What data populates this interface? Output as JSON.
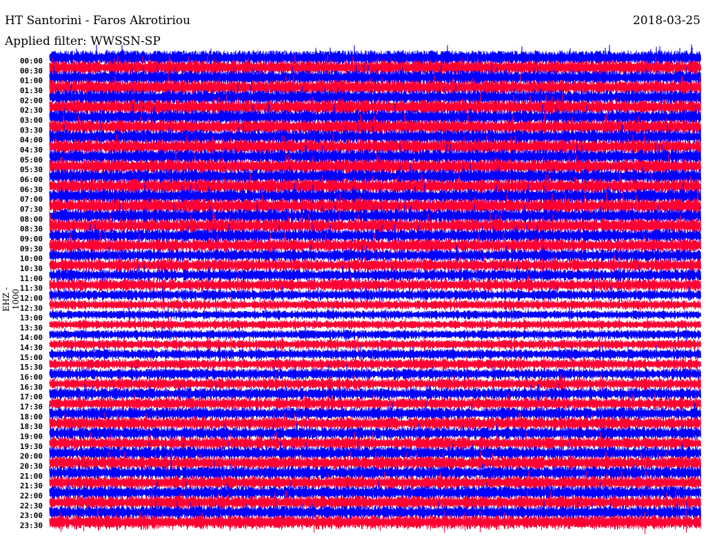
{
  "header": {
    "station": "HT Santorini - Faros Akrotiriou",
    "date": "2018-03-25",
    "filter": "Applied filter: WWSSN-SP",
    "channel": "EHZ - 1000"
  },
  "colors": {
    "trace_a": "#0000ff",
    "trace_b": "#ff0033"
  },
  "chart_data": {
    "type": "line",
    "title": "HT Santorini - Faros Akrotiriou",
    "subtitle": "Applied filter: WWSSN-SP",
    "ylabel": "EHZ - 1000",
    "row_labels": [
      "00:00",
      "00:30",
      "01:00",
      "01:30",
      "02:00",
      "02:30",
      "03:00",
      "03:30",
      "04:00",
      "04:30",
      "05:00",
      "05:30",
      "06:00",
      "06:30",
      "07:00",
      "07:30",
      "08:00",
      "08:30",
      "09:00",
      "09:30",
      "10:00",
      "10:30",
      "11:00",
      "11:30",
      "12:00",
      "12:30",
      "13:00",
      "13:30",
      "14:00",
      "14:30",
      "15:00",
      "15:30",
      "16:00",
      "16:30",
      "17:00",
      "17:30",
      "18:00",
      "18:30",
      "19:00",
      "19:30",
      "20:00",
      "20:30",
      "21:00",
      "21:30",
      "22:00",
      "22:30",
      "23:00",
      "23:30"
    ],
    "relative_amplitude": [
      1.0,
      1.0,
      1.0,
      1.0,
      1.0,
      1.0,
      1.0,
      1.0,
      1.0,
      1.0,
      1.0,
      1.0,
      1.0,
      1.0,
      1.0,
      1.0,
      0.95,
      0.95,
      0.9,
      0.9,
      0.85,
      0.85,
      0.8,
      0.8,
      0.7,
      0.65,
      0.6,
      0.6,
      0.65,
      0.65,
      0.7,
      0.7,
      0.75,
      0.75,
      0.8,
      0.8,
      0.85,
      0.85,
      0.85,
      0.85,
      0.9,
      0.9,
      0.9,
      0.9,
      0.9,
      0.9,
      0.9,
      0.95
    ],
    "trace_minutes": 30
  }
}
